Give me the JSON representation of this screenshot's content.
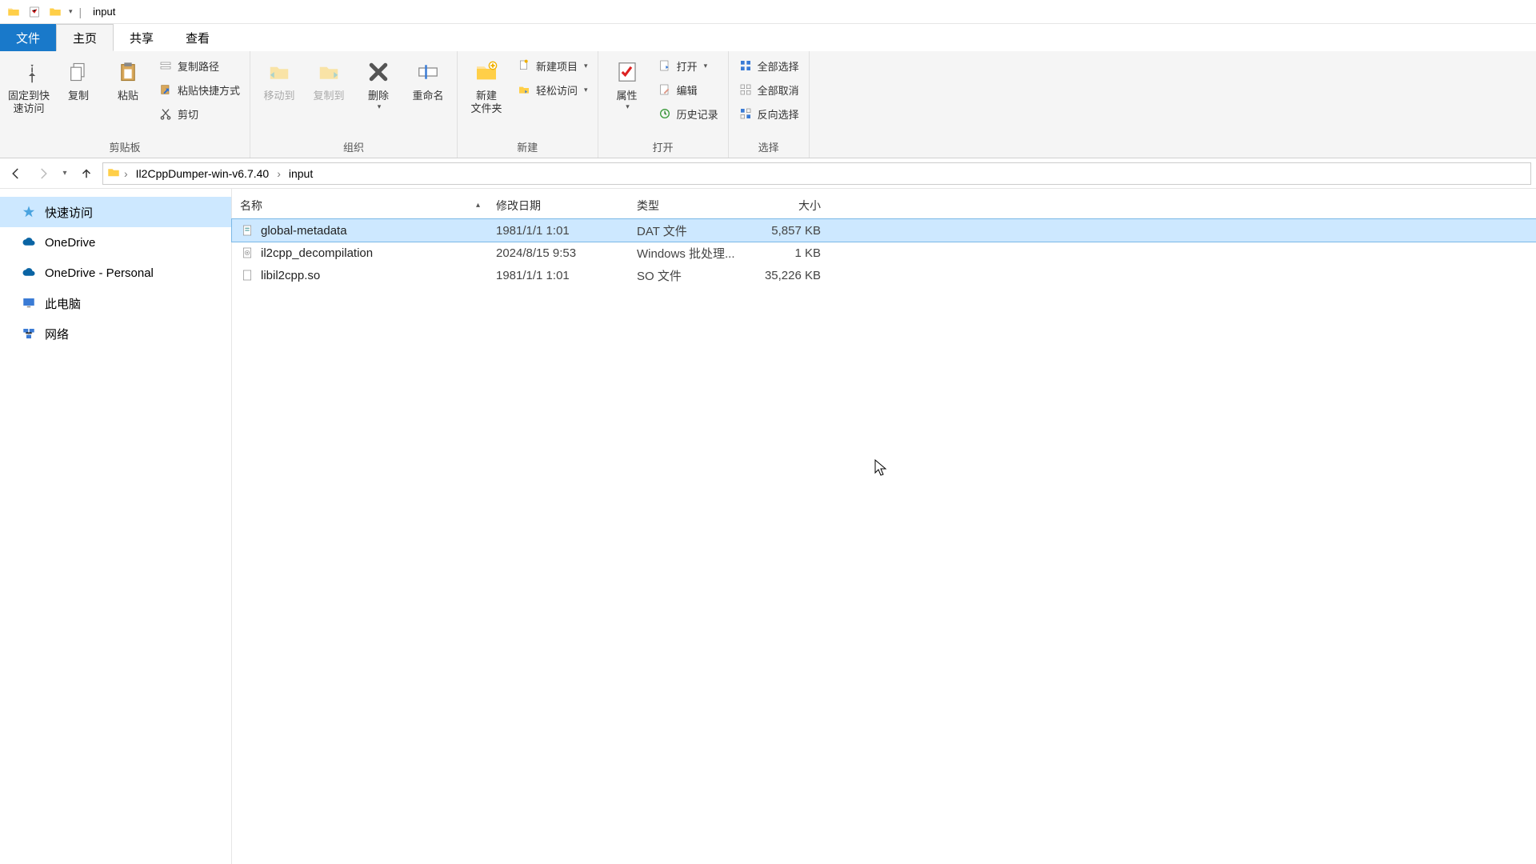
{
  "window": {
    "title": "input"
  },
  "tabs": {
    "file": "文件",
    "home": "主页",
    "share": "共享",
    "view": "查看"
  },
  "ribbon": {
    "clipboard": {
      "pin": "固定到快\n速访问",
      "copy": "复制",
      "paste": "粘贴",
      "copy_path": "复制路径",
      "paste_shortcut": "粘贴快捷方式",
      "cut": "剪切",
      "group": "剪贴板"
    },
    "organize": {
      "move_to": "移动到",
      "copy_to": "复制到",
      "delete": "删除",
      "rename": "重命名",
      "group": "组织"
    },
    "new": {
      "new_folder": "新建\n文件夹",
      "new_item": "新建项目",
      "easy_access": "轻松访问",
      "group": "新建"
    },
    "open": {
      "properties": "属性",
      "open": "打开",
      "edit": "编辑",
      "history": "历史记录",
      "group": "打开"
    },
    "select": {
      "select_all": "全部选择",
      "select_none": "全部取消",
      "invert": "反向选择",
      "group": "选择"
    }
  },
  "breadcrumb": {
    "parent": "Il2CppDumper-win-v6.7.40",
    "current": "input"
  },
  "sidebar": {
    "items": [
      {
        "label": "快速访问"
      },
      {
        "label": "OneDrive"
      },
      {
        "label": "OneDrive - Personal"
      },
      {
        "label": "此电脑"
      },
      {
        "label": "网络"
      }
    ]
  },
  "columns": {
    "name": "名称",
    "date": "修改日期",
    "type": "类型",
    "size": "大小"
  },
  "files": [
    {
      "name": "global-metadata",
      "date": "1981/1/1 1:01",
      "type": "DAT 文件",
      "size": "5,857 KB",
      "icon": "dat",
      "selected": true
    },
    {
      "name": "il2cpp_decompilation",
      "date": "2024/8/15 9:53",
      "type": "Windows 批处理...",
      "size": "1 KB",
      "icon": "bat",
      "selected": false
    },
    {
      "name": "libil2cpp.so",
      "date": "1981/1/1 1:01",
      "type": "SO 文件",
      "size": "35,226 KB",
      "icon": "so",
      "selected": false
    }
  ]
}
